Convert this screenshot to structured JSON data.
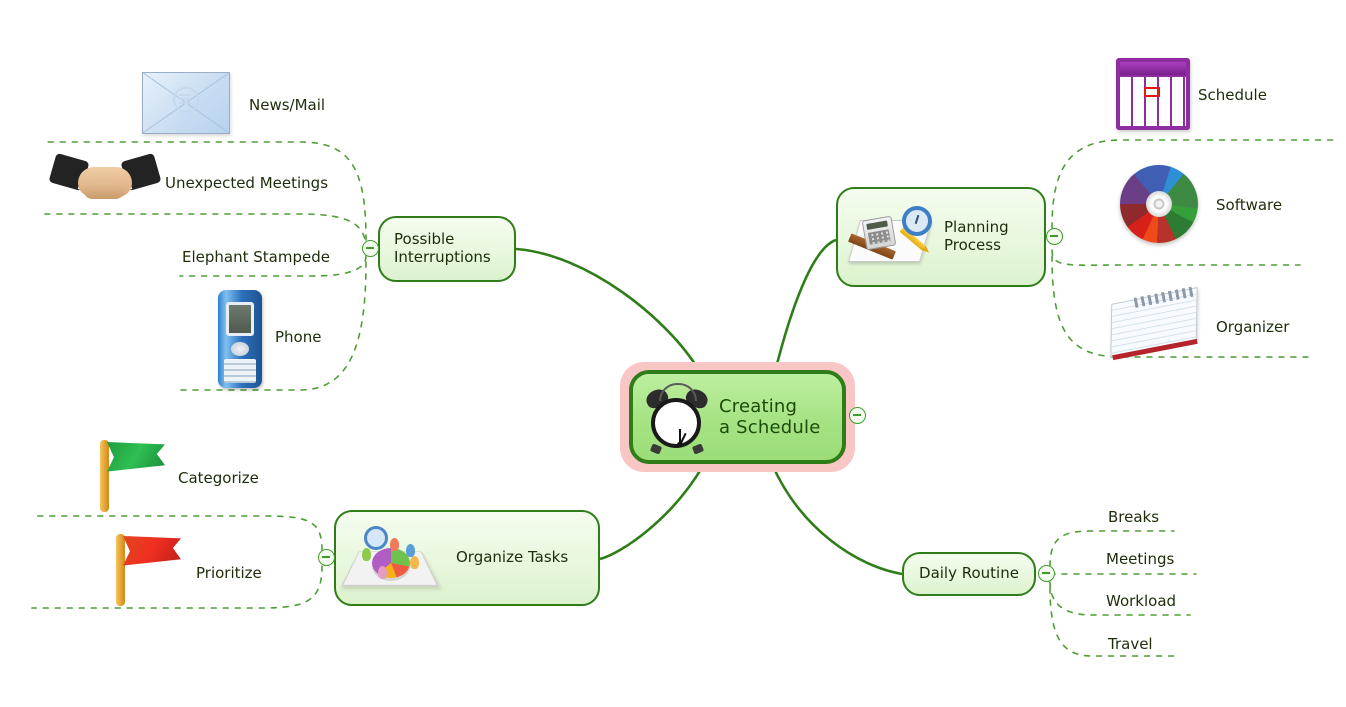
{
  "diagram": {
    "title": "Creating a Schedule",
    "type": "mind-map",
    "colors": {
      "branch_line": "#2f7d19",
      "node_border": "#2f7d19",
      "central_highlight": "#f9c6c6",
      "central_fill": "#a6e383",
      "dotted_boundary": "#4e9e35",
      "text": "#1d2d0a"
    }
  },
  "central": {
    "label": "Creating\na Schedule",
    "icon": "alarm-clock-icon",
    "collapse_label": "−"
  },
  "branches": [
    {
      "id": "possible-interruptions",
      "label": "Possible\nInterruptions",
      "icon": null,
      "collapse_label": "−",
      "children": [
        {
          "label": "News/Mail",
          "icon": "envelope-icon"
        },
        {
          "label": "Unexpected Meetings",
          "icon": "handshake-icon"
        },
        {
          "label": "Elephant Stampede",
          "icon": null
        },
        {
          "label": "Phone",
          "icon": "mobile-phone-icon"
        }
      ]
    },
    {
      "id": "planning-process",
      "label": "Planning\nProcess",
      "icon": "calculator-ruler-clock-icon",
      "collapse_label": "−",
      "children": [
        {
          "label": "Schedule",
          "icon": "calendar-icon"
        },
        {
          "label": "Software",
          "icon": "cd-disc-icon"
        },
        {
          "label": "Organizer",
          "icon": "notepad-icon"
        }
      ]
    },
    {
      "id": "organize-tasks",
      "label": "Organize Tasks",
      "icon": "pie-chart-board-icon",
      "collapse_label": "−",
      "children": [
        {
          "label": "Categorize",
          "icon": "green-flag-icon"
        },
        {
          "label": "Prioritize",
          "icon": "red-flag-icon"
        }
      ]
    },
    {
      "id": "daily-routine",
      "label": "Daily Routine",
      "icon": null,
      "collapse_label": "−",
      "children": [
        {
          "label": "Breaks",
          "icon": null
        },
        {
          "label": "Meetings",
          "icon": null
        },
        {
          "label": "Workload",
          "icon": null
        },
        {
          "label": "Travel",
          "icon": null
        }
      ]
    }
  ]
}
